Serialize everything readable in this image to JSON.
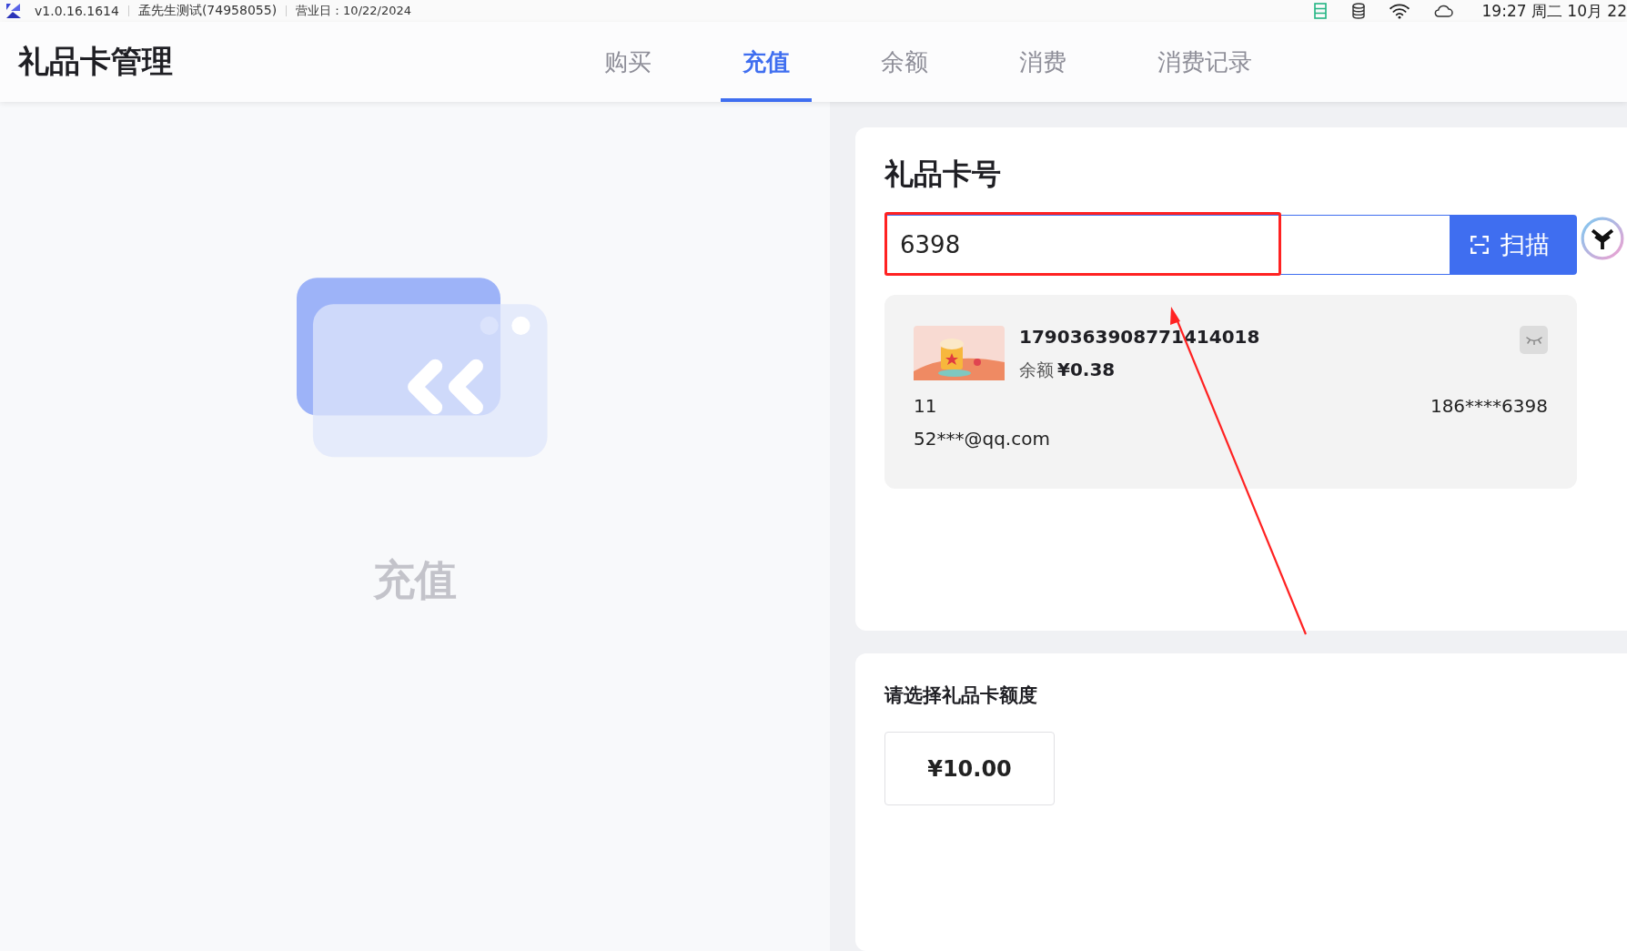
{
  "status_bar": {
    "version": "v1.0.16.1614",
    "store": "孟先生测试(74958055)",
    "business_day": "营业日：10/22/2024",
    "clock": "19:27 周二 10月 22"
  },
  "header": {
    "title": "礼品卡管理"
  },
  "tabs": [
    {
      "label": "购买",
      "selected": false
    },
    {
      "label": "充值",
      "selected": true
    },
    {
      "label": "余额",
      "selected": false
    },
    {
      "label": "消费",
      "selected": false
    },
    {
      "label": "消费记录",
      "selected": false
    }
  ],
  "empty_panel": {
    "label": "充值"
  },
  "card_lookup": {
    "title": "礼品卡号",
    "input_value": "6398",
    "scan_button": "扫描"
  },
  "gift_card": {
    "number": "1790363908771414018",
    "balance_label": "余额",
    "balance": "¥0.38",
    "holder": "11",
    "phone": "186****6398",
    "email": "52***@qq.com"
  },
  "amount_section": {
    "title": "请选择礼品卡额度",
    "options": [
      {
        "label": "¥10.00",
        "selected": false
      }
    ]
  }
}
